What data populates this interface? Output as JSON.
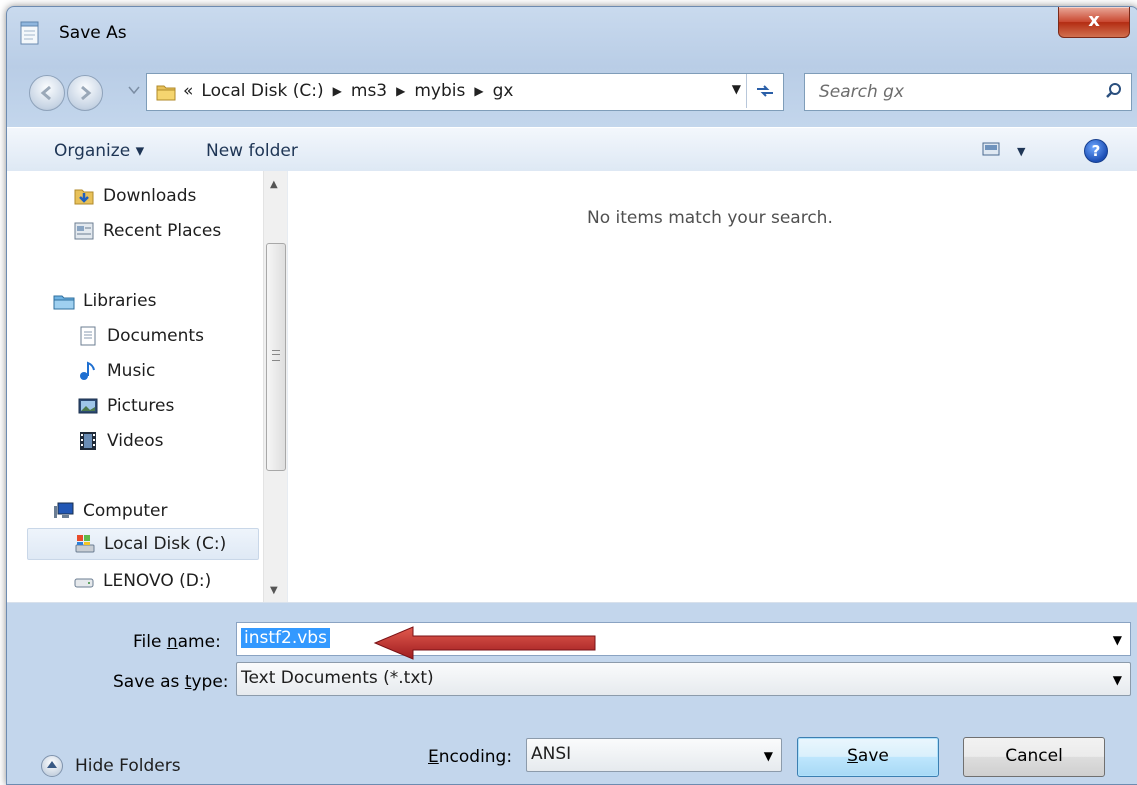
{
  "window": {
    "title": "Save As",
    "close_label": "x"
  },
  "address_bar": {
    "overflow_marker": "«",
    "breadcrumbs": [
      "Local Disk (C:)",
      "ms3",
      "mybis",
      "gx"
    ]
  },
  "search": {
    "placeholder": "Search gx"
  },
  "toolbar": {
    "organize_label": "Organize ▾",
    "new_folder_label": "New folder",
    "help_label": "?"
  },
  "nav_pane": {
    "items": [
      {
        "label": "Downloads",
        "icon": "downloads-folder-icon"
      },
      {
        "label": "Recent Places",
        "icon": "recent-places-icon"
      },
      {
        "label": "Libraries",
        "icon": "libraries-icon"
      },
      {
        "label": "Documents",
        "icon": "documents-icon"
      },
      {
        "label": "Music",
        "icon": "music-icon"
      },
      {
        "label": "Pictures",
        "icon": "pictures-icon"
      },
      {
        "label": "Videos",
        "icon": "videos-icon"
      },
      {
        "label": "Computer",
        "icon": "computer-icon"
      },
      {
        "label": "Local Disk (C:)",
        "icon": "local-disk-icon",
        "selected": true
      },
      {
        "label": "LENOVO (D:)",
        "icon": "drive-icon"
      }
    ]
  },
  "file_list": {
    "empty_message": "No items match your search."
  },
  "form": {
    "file_name_label_pre": "File ",
    "file_name_label_key": "n",
    "file_name_label_post": "ame:",
    "file_name_value": "instf2.vbs",
    "save_type_label_pre": "Save as ",
    "save_type_label_key": "t",
    "save_type_label_post": "ype:",
    "save_type_value": "Text Documents (*.txt)",
    "encoding_label_key": "E",
    "encoding_label_post": "ncoding:",
    "encoding_value": "ANSI"
  },
  "buttons": {
    "hide_folders_label": "Hide Folders",
    "save_label_key": "S",
    "save_label_post": "ave",
    "cancel_label": "Cancel"
  },
  "colors": {
    "selection": "#3399ff",
    "annotation_arrow": "#c0262c"
  }
}
